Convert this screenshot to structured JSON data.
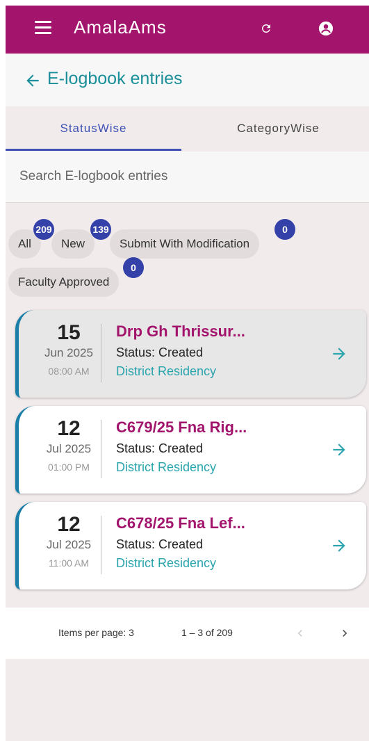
{
  "appbar": {
    "title": "AmalaAms",
    "menu_icon": "menu-icon",
    "refresh_icon": "refresh-icon",
    "account_icon": "account-circle-icon",
    "color": "#a3156d"
  },
  "header": {
    "title": "E-logbook entries",
    "back_icon": "arrow-left-icon",
    "title_color": "#1a8f9a"
  },
  "tabs": [
    {
      "label": "StatusWise",
      "active": true
    },
    {
      "label": "CategoryWise",
      "active": false
    }
  ],
  "search": {
    "placeholder": "Search E-logbook entries",
    "value": ""
  },
  "chips": [
    {
      "label": "All",
      "badge": "209"
    },
    {
      "label": "New",
      "badge": "139"
    },
    {
      "label": "Submit With Modification",
      "badge": "0"
    },
    {
      "label": "Faculty Approved",
      "badge": "0"
    }
  ],
  "entries": [
    {
      "day": "15",
      "month": "Jun 2025",
      "time": "08:00 AM",
      "title": "Drp Gh Thrissur...",
      "status": "Status: Created",
      "dept": "District Residency"
    },
    {
      "day": "12",
      "month": "Jul 2025",
      "time": "01:00 PM",
      "title": "C679/25 Fna Rig...",
      "status": "Status: Created",
      "dept": "District Residency"
    },
    {
      "day": "12",
      "month": "Jul 2025",
      "time": "11:00 AM",
      "title": "C678/25 Fna Lef...",
      "status": "Status: Created",
      "dept": "District Residency"
    }
  ],
  "paginator": {
    "items_per_page": "Items per page: 3",
    "range": "1 – 3 of 209"
  }
}
